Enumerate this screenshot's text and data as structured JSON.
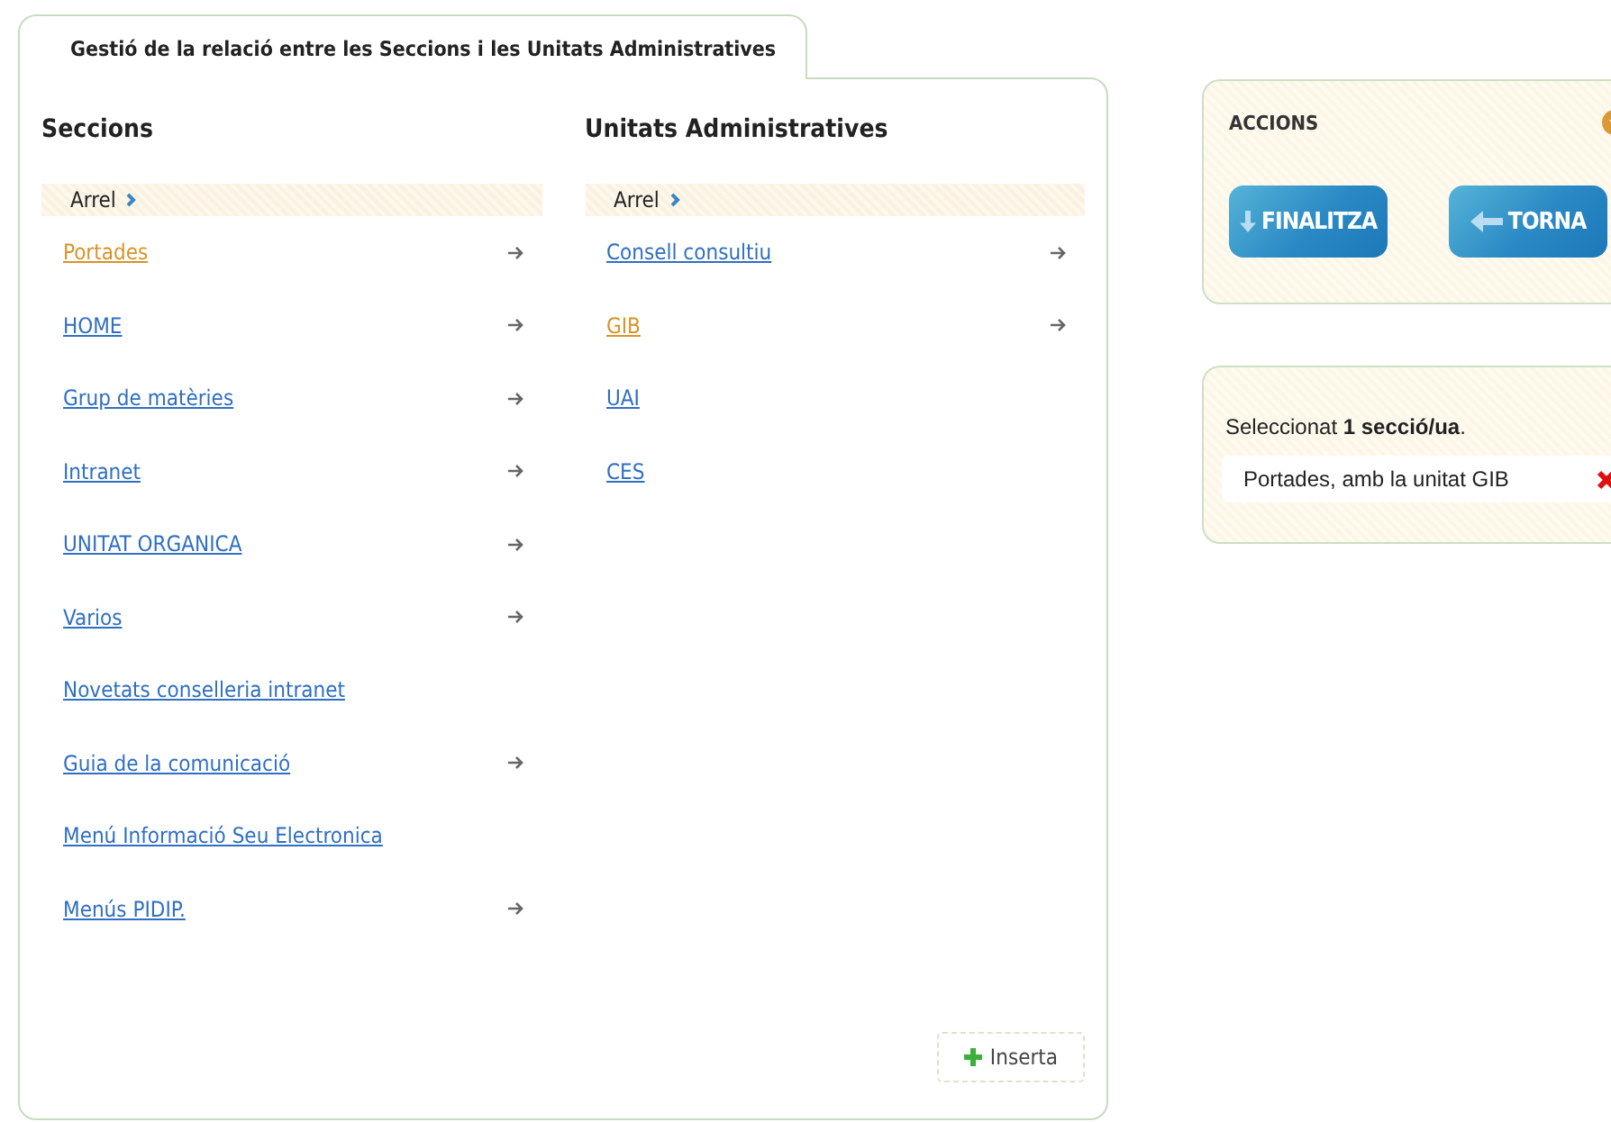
{
  "tab": {
    "label": "Gestió de la relació entre les Seccions i les Unitats Administratives",
    "selected": true
  },
  "columns": [
    {
      "heading": "Seccions",
      "breadcrumb": "Arrel",
      "items": [
        {
          "label": "Portades",
          "selected": true,
          "has_children": true
        },
        {
          "label": "HOME",
          "selected": false,
          "has_children": true
        },
        {
          "label": "Grup de matèries",
          "selected": false,
          "has_children": true
        },
        {
          "label": "Intranet",
          "selected": false,
          "has_children": true
        },
        {
          "label": "UNITAT ORGANICA",
          "selected": false,
          "has_children": true
        },
        {
          "label": "Varios",
          "selected": false,
          "has_children": true
        },
        {
          "label": "Novetats conselleria intranet",
          "selected": false,
          "has_children": false
        },
        {
          "label": "Guia de la comunicació",
          "selected": false,
          "has_children": true
        },
        {
          "label": "Menú Informació Seu Electronica",
          "selected": false,
          "has_children": false
        },
        {
          "label": "Menús PIDIP.",
          "selected": false,
          "has_children": true
        }
      ]
    },
    {
      "heading": "Unitats Administratives",
      "breadcrumb": "Arrel",
      "items": [
        {
          "label": "Consell consultiu",
          "selected": false,
          "has_children": true
        },
        {
          "label": "GIB",
          "selected": true,
          "has_children": true
        },
        {
          "label": "UAI",
          "selected": false,
          "has_children": false
        },
        {
          "label": "CES",
          "selected": false,
          "has_children": false
        }
      ]
    }
  ],
  "insert_button": "Inserta",
  "actions": {
    "title": "ACCIONS",
    "buttons": [
      {
        "label": "FINALITZA",
        "kind": "down"
      },
      {
        "label": "TORNA",
        "kind": "back"
      }
    ]
  },
  "selection": {
    "summary": "Seleccionat **1 secció/ua**.",
    "items": [
      "Portades, amb la unitat GIB"
    ]
  }
}
